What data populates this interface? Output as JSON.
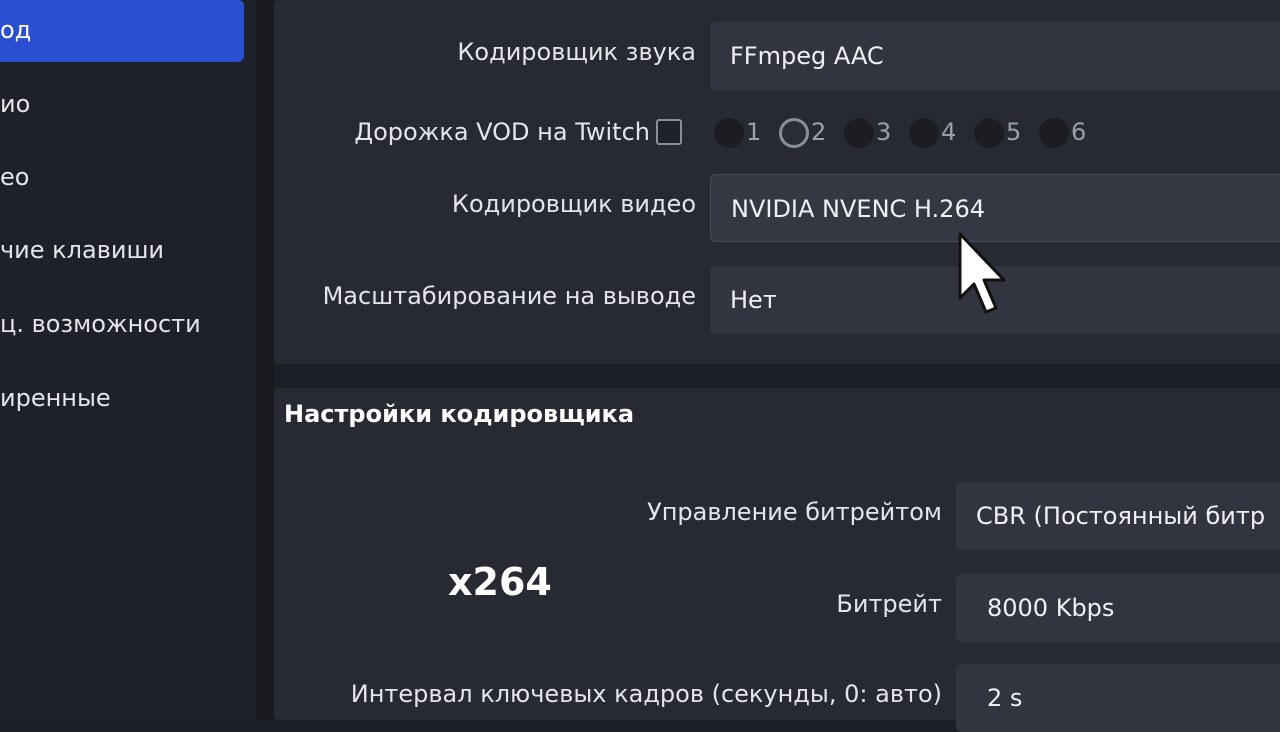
{
  "sidebar": {
    "items": [
      {
        "label": "од",
        "active": true
      },
      {
        "label": "ио",
        "active": false
      },
      {
        "label": "ео",
        "active": false
      },
      {
        "label": "чие клавиши",
        "active": false
      },
      {
        "label": "ц. возможности",
        "active": false
      },
      {
        "label": "иренные",
        "active": false
      }
    ]
  },
  "output": {
    "audio_encoder_label": "Кодировщик звука",
    "audio_encoder_value": "FFmpeg AAC",
    "vod_track_label": "Дорожка VOD на Twitch",
    "vod_tracks": [
      "1",
      "2",
      "3",
      "4",
      "5",
      "6"
    ],
    "vod_selected_track": "2",
    "video_encoder_label": "Кодировщик видео",
    "video_encoder_value": "NVIDIA NVENC H.264",
    "rescale_label": "Масштабирование на выводе",
    "rescale_value": "Нет"
  },
  "encoder_settings": {
    "title": "Настройки кодировщика",
    "rate_control_label": "Управление битрейтом",
    "rate_control_value": "CBR (Постоянный битр",
    "bitrate_label": "Битрейт",
    "bitrate_value": "8000 Kbps",
    "keyframe_label": "Интервал ключевых кадров (секунды, 0: авто)",
    "keyframe_value": "2 s"
  },
  "overlay_text": "x264",
  "colors": {
    "accent": "#2a4fd1",
    "background": "#1d1f26",
    "panel": "#272a33",
    "field": "#32353f"
  }
}
